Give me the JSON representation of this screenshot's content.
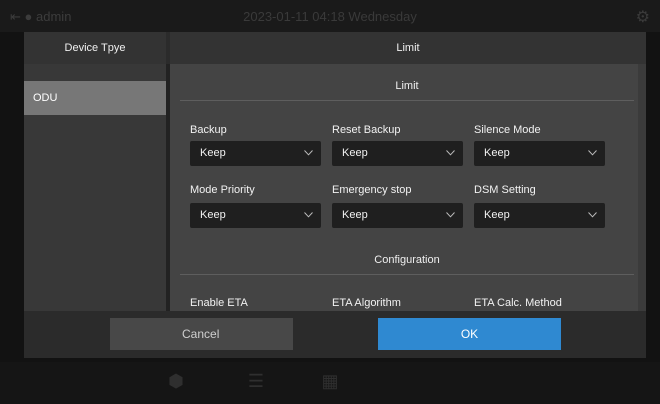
{
  "background": {
    "user": "admin",
    "datetime": "2023-01-11 04:18 Wednesday",
    "icons": [
      "home-icon",
      "list-icon",
      "calendar-icon"
    ]
  },
  "dialog": {
    "sidebar_title": "Device Tpye",
    "main_title": "Limit",
    "sidebar_items": [
      {
        "label": "ODU",
        "selected": true
      }
    ],
    "sections": [
      {
        "title": "Limit",
        "fields": [
          {
            "label": "Backup",
            "value": "Keep"
          },
          {
            "label": "Reset Backup",
            "value": "Keep"
          },
          {
            "label": "Silence Mode",
            "value": "Keep"
          },
          {
            "label": "Mode Priority",
            "value": "Keep"
          },
          {
            "label": "Emergency stop",
            "value": "Keep"
          },
          {
            "label": "DSM Setting",
            "value": "Keep"
          }
        ]
      },
      {
        "title": "Configuration",
        "fields": [
          {
            "label": "Enable ETA"
          },
          {
            "label": "ETA Algorithm"
          },
          {
            "label": "ETA Calc. Method"
          }
        ]
      }
    ],
    "buttons": {
      "cancel": "Cancel",
      "ok": "OK"
    }
  },
  "colors": {
    "accent": "#2f89d1",
    "selected_item": "#777777",
    "panel": "#444444"
  }
}
